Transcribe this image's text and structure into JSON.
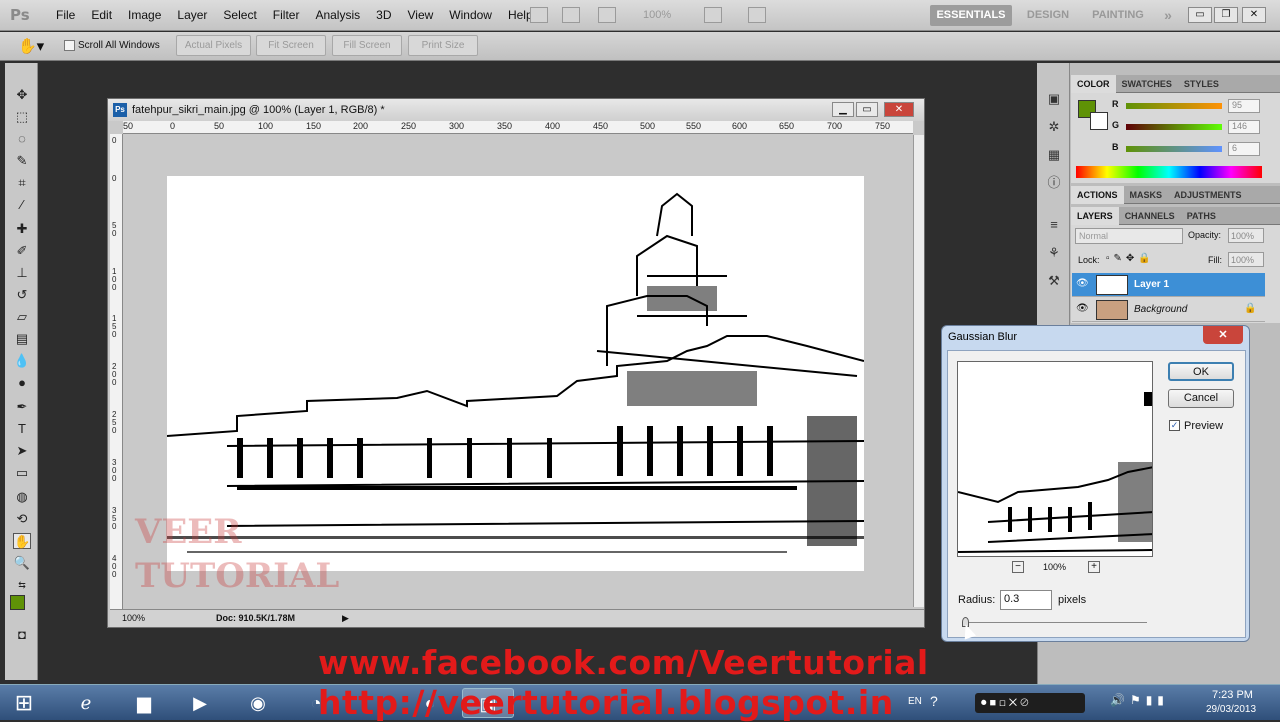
{
  "app": {
    "logo": "Ps"
  },
  "menu": [
    "File",
    "Edit",
    "Image",
    "Layer",
    "Select",
    "Filter",
    "Analysis",
    "3D",
    "View",
    "Window",
    "Help"
  ],
  "zoom_menu": "100%",
  "workspaces": [
    "ESSENTIALS",
    "DESIGN",
    "PAINTING"
  ],
  "workspace_more": "»",
  "options": {
    "scroll_all": "Scroll All Windows",
    "actual_pixels": "Actual Pixels",
    "fit_screen": "Fit Screen",
    "fill_screen": "Fill Screen",
    "print_size": "Print Size"
  },
  "document": {
    "title": "fatehpur_sikri_main.jpg @ 100% (Layer 1, RGB/8) *",
    "icon": "Ps",
    "zoom": "100%",
    "doc_info": "Doc: 910.5K/1.78M"
  },
  "ruler_top": [
    "50",
    "0",
    "50",
    "100",
    "150",
    "200",
    "250",
    "300",
    "350",
    "400",
    "450",
    "500",
    "550",
    "600",
    "650",
    "700",
    "750"
  ],
  "ruler_left": [
    "0",
    "0",
    "5",
    "0",
    "1",
    "0",
    "0",
    "1",
    "5",
    "0",
    "2",
    "0",
    "0",
    "2",
    "5",
    "0",
    "3",
    "0",
    "0",
    "3",
    "5",
    "0",
    "4",
    "0",
    "0"
  ],
  "color_panel": {
    "tabs": [
      "COLOR",
      "SWATCHES",
      "STYLES"
    ],
    "channels": [
      {
        "label": "R",
        "value": "95"
      },
      {
        "label": "G",
        "value": "146"
      },
      {
        "label": "B",
        "value": "6"
      }
    ],
    "fg": "#5f9206"
  },
  "actions_panel": {
    "tabs": [
      "ACTIONS",
      "MASKS",
      "ADJUSTMENTS"
    ]
  },
  "layers_panel": {
    "tabs": [
      "LAYERS",
      "CHANNELS",
      "PATHS"
    ],
    "blend_mode": "Normal",
    "opacity_label": "Opacity:",
    "opacity": "100%",
    "lock_label": "Lock:",
    "fill_label": "Fill:",
    "fill": "100%",
    "layers": [
      {
        "name": "Layer 1",
        "selected": true
      },
      {
        "name": "Background",
        "selected": false
      }
    ]
  },
  "dialog": {
    "title": "Gaussian Blur",
    "ok": "OK",
    "cancel": "Cancel",
    "preview_label": "Preview",
    "preview_zoom": "100%",
    "zoom_out": "−",
    "zoom_in": "+",
    "radius_label": "Radius:",
    "radius_value": "0.3",
    "radius_unit": "pixels",
    "close": "✕"
  },
  "overlay": {
    "line1": "www.facebook.com/Veertutorial",
    "line2": "http://veertutorial.blogspot.in"
  },
  "taskbar": {
    "lang": "EN",
    "time": "7:23 PM",
    "date": "29/03/2013"
  },
  "colors": {
    "accent": "#3d8fd6",
    "watermark": "#e21a1a"
  }
}
